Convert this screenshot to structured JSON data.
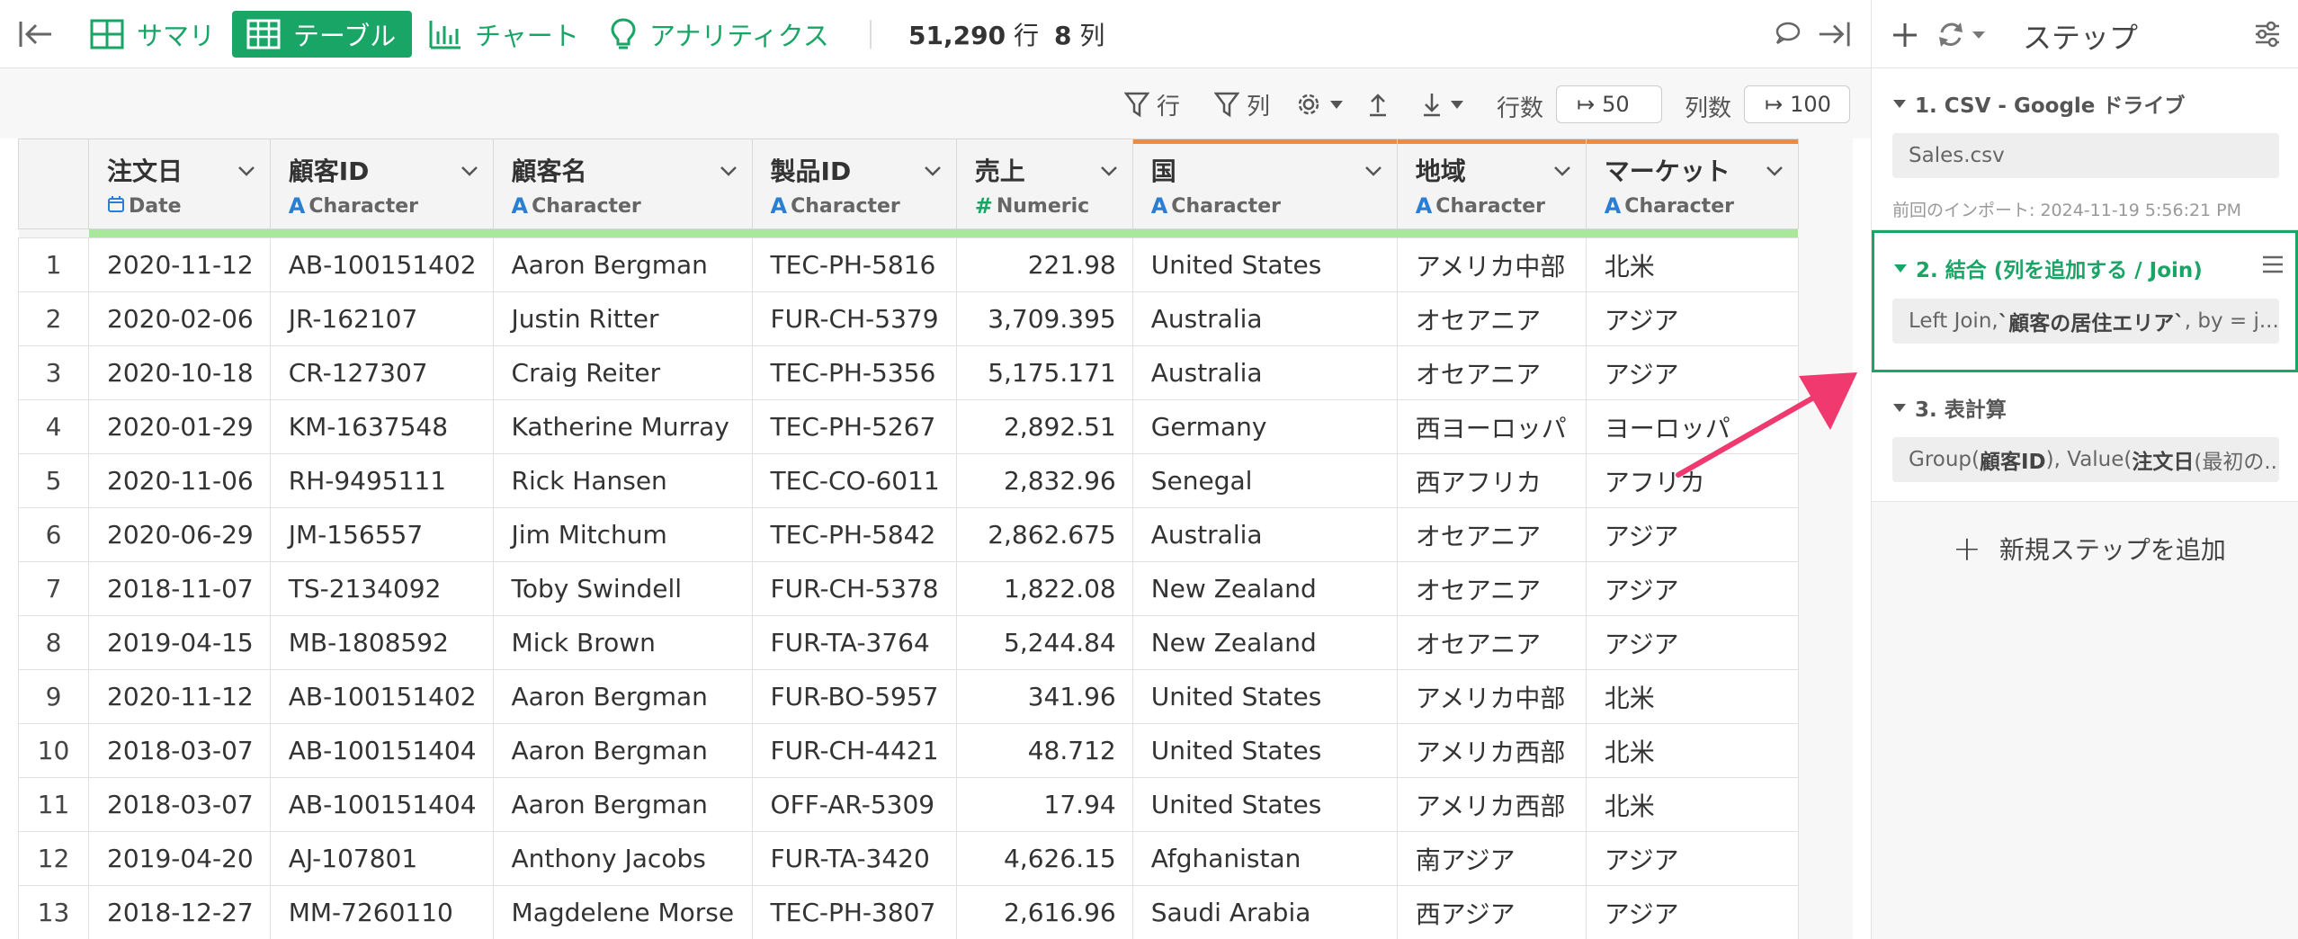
{
  "toolbar": {
    "tabs": [
      {
        "label": "サマリ",
        "active": false
      },
      {
        "label": "テーブル",
        "active": true
      },
      {
        "label": "チャート",
        "active": false
      },
      {
        "label": "アナリティクス",
        "active": false
      }
    ],
    "rows_value": "51,290",
    "rows_unit": "行",
    "cols_value": "8",
    "cols_unit": "列"
  },
  "subtoolbar": {
    "filter_rows": "行",
    "filter_cols": "列",
    "row_count_label": "行数",
    "row_count_value": "50",
    "col_count_label": "列数",
    "col_count_value": "100"
  },
  "columns": [
    {
      "name": "注文日",
      "type": "Date",
      "type_icon": "calendar-icon",
      "align": "left"
    },
    {
      "name": "顧客ID",
      "type": "Character",
      "type_icon": "A",
      "align": "left"
    },
    {
      "name": "顧客名",
      "type": "Character",
      "type_icon": "A",
      "align": "left"
    },
    {
      "name": "製品ID",
      "type": "Character",
      "type_icon": "A",
      "align": "left"
    },
    {
      "name": "売上",
      "type": "Numeric",
      "type_icon": "#",
      "align": "right"
    },
    {
      "name": "国",
      "type": "Character",
      "type_icon": "A",
      "align": "left",
      "highlight": true
    },
    {
      "name": "地域",
      "type": "Character",
      "type_icon": "A",
      "align": "left",
      "highlight": true
    },
    {
      "name": "マーケット",
      "type": "Character",
      "type_icon": "A",
      "align": "left",
      "highlight": true
    }
  ],
  "rows": [
    [
      "1",
      "2020-11-12",
      "AB-100151402",
      "Aaron Bergman",
      "TEC-PH-5816",
      "221.98",
      "United States",
      "アメリカ中部",
      "北米"
    ],
    [
      "2",
      "2020-02-06",
      "JR-162107",
      "Justin Ritter",
      "FUR-CH-5379",
      "3,709.395",
      "Australia",
      "オセアニア",
      "アジア"
    ],
    [
      "3",
      "2020-10-18",
      "CR-127307",
      "Craig Reiter",
      "TEC-PH-5356",
      "5,175.171",
      "Australia",
      "オセアニア",
      "アジア"
    ],
    [
      "4",
      "2020-01-29",
      "KM-1637548",
      "Katherine Murray",
      "TEC-PH-5267",
      "2,892.51",
      "Germany",
      "西ヨーロッパ",
      "ヨーロッパ"
    ],
    [
      "5",
      "2020-11-06",
      "RH-9495111",
      "Rick Hansen",
      "TEC-CO-6011",
      "2,832.96",
      "Senegal",
      "西アフリカ",
      "アフリカ"
    ],
    [
      "6",
      "2020-06-29",
      "JM-156557",
      "Jim Mitchum",
      "TEC-PH-5842",
      "2,862.675",
      "Australia",
      "オセアニア",
      "アジア"
    ],
    [
      "7",
      "2018-11-07",
      "TS-2134092",
      "Toby Swindell",
      "FUR-CH-5378",
      "1,822.08",
      "New Zealand",
      "オセアニア",
      "アジア"
    ],
    [
      "8",
      "2019-04-15",
      "MB-1808592",
      "Mick Brown",
      "FUR-TA-3764",
      "5,244.84",
      "New Zealand",
      "オセアニア",
      "アジア"
    ],
    [
      "9",
      "2020-11-12",
      "AB-100151402",
      "Aaron Bergman",
      "FUR-BO-5957",
      "341.96",
      "United States",
      "アメリカ中部",
      "北米"
    ],
    [
      "10",
      "2018-03-07",
      "AB-100151404",
      "Aaron Bergman",
      "FUR-CH-4421",
      "48.712",
      "United States",
      "アメリカ西部",
      "北米"
    ],
    [
      "11",
      "2018-03-07",
      "AB-100151404",
      "Aaron Bergman",
      "OFF-AR-5309",
      "17.94",
      "United States",
      "アメリカ西部",
      "北米"
    ],
    [
      "12",
      "2019-04-20",
      "AJ-107801",
      "Anthony Jacobs",
      "FUR-TA-3420",
      "4,626.15",
      "Afghanistan",
      "南アジア",
      "アジア"
    ],
    [
      "13",
      "2018-12-27",
      "MM-7260110",
      "Magdelene Morse",
      "TEC-PH-3807",
      "2,616.96",
      "Saudi Arabia",
      "西アジア",
      "アジア"
    ]
  ],
  "panel": {
    "title": "ステップ",
    "steps": [
      {
        "title": "1. CSV - Google ドライブ",
        "box": "Sales.csv",
        "meta": "前回のインポート: 2024-11-19 5:56:21 PM"
      },
      {
        "title": "2. 結合 (列を追加する / Join)",
        "box_pre": "Left Join, ",
        "box_bold": "`顧客の居住エリア`",
        "box_post": ", by = j..."
      },
      {
        "title": "3. 表計算",
        "box_pre": "Group(",
        "box_bold": "顧客ID",
        "box_mid": "), Value(",
        "box_bold2": "注文日",
        "box_post": " (最初の..."
      }
    ],
    "add_step": "新規ステップを追加"
  },
  "colors": {
    "accent": "#18a566",
    "highlight_top": "#f08a3c",
    "quality_bar": "#a8e89a",
    "arrow": "#f0396e"
  }
}
